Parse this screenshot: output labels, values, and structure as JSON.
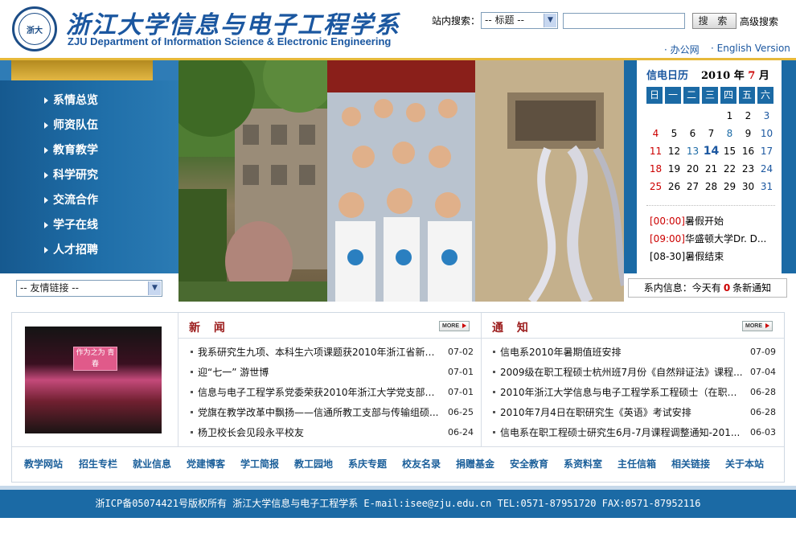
{
  "header": {
    "logo_text": "浙大",
    "title_cn": "浙江大学信息与电子工程学系",
    "title_en": "ZJU Department of Information Science & Electronic Engineering",
    "search_label": "站内搜索：",
    "search_select_value": "-- 标题 --",
    "search_button": "搜 索",
    "advanced_search": "高级搜索",
    "office_link": "· 办公网",
    "english_link": "· English Version"
  },
  "nav": {
    "items": [
      {
        "label": "系情总览"
      },
      {
        "label": "师资队伍"
      },
      {
        "label": "教育教学"
      },
      {
        "label": "科学研究"
      },
      {
        "label": "交流合作"
      },
      {
        "label": "学子在线"
      },
      {
        "label": "人才招聘"
      }
    ],
    "friend_links_value": "-- 友情链接 --"
  },
  "calendar": {
    "title": "信电日历",
    "year_text": "2010 年",
    "month": "7",
    "month_suffix": "月",
    "weekdays": [
      "日",
      "一",
      "二",
      "三",
      "四",
      "五",
      "六"
    ],
    "days": [
      [
        "",
        "",
        "",
        "",
        "1",
        "2",
        "3"
      ],
      [
        "4",
        "5",
        "6",
        "7",
        "8",
        "9",
        "10"
      ],
      [
        "11",
        "12",
        "13",
        "14",
        "15",
        "16",
        "17"
      ],
      [
        "18",
        "19",
        "20",
        "21",
        "22",
        "23",
        "24"
      ],
      [
        "25",
        "26",
        "27",
        "28",
        "29",
        "30",
        "31"
      ]
    ],
    "today": "14",
    "events": [
      {
        "time": "[00:00]",
        "text": "暑假开始"
      },
      {
        "time": "[09:00]",
        "text": "华盛顿大学Dr. D..."
      },
      {
        "time": "[08-30]",
        "text": "暑假结束"
      }
    ]
  },
  "notice_box": {
    "prefix": "系内信息：今天有",
    "count": "0",
    "suffix": "条新通知"
  },
  "photo_caption": "作为之为 青春",
  "news": {
    "title": "新 闻",
    "more": "MORE",
    "items": [
      {
        "text": "我系研究生九项、本科生六项课题获2010年浙江省新苗...",
        "date": "07-02"
      },
      {
        "text": "迎“七一” 游世博",
        "date": "07-01"
      },
      {
        "text": "信息与电子工程学系党委荣获2010年浙江大学党支部建...",
        "date": "07-01"
      },
      {
        "text": "党旗在教学改革中飘扬——信通所教工支部与传输组硕...",
        "date": "06-25"
      },
      {
        "text": "杨卫校长会见段永平校友",
        "date": "06-24"
      }
    ]
  },
  "notices": {
    "title": "通 知",
    "more": "MORE",
    "items": [
      {
        "text": "信电系2010年暑期值班安排",
        "date": "07-09"
      },
      {
        "text": "2009级在职工程硕士杭州班7月份《自然辩证法》课程...",
        "date": "07-04"
      },
      {
        "text": "2010年浙江大学信息与电子工程学系工程硕士（在职）招...",
        "date": "06-28"
      },
      {
        "text": "2010年7月4日在职研究生《英语》考试安排",
        "date": "06-28"
      },
      {
        "text": "信电系在职工程硕士研究生6月-7月课程调整通知-201...",
        "date": "06-03"
      }
    ]
  },
  "links": [
    "教学网站",
    "招生专栏",
    "就业信息",
    "党建博客",
    "学工简报",
    "教工园地",
    "系庆专题",
    "校友名录",
    "捐赠基金",
    "安全教育",
    "系资料室",
    "主任信箱",
    "相关链接",
    "关于本站"
  ],
  "footer": {
    "text": "浙ICP备05074421号版权所有 浙江大学信息与电子工程学系 E-mail:isee@zju.edu.cn TEL:0571-87951720 FAX:0571-87952116"
  },
  "colors": {
    "brand_blue": "#1b6aa5",
    "accent_gold": "#e6b93a",
    "title_red": "#9b1a1a"
  }
}
